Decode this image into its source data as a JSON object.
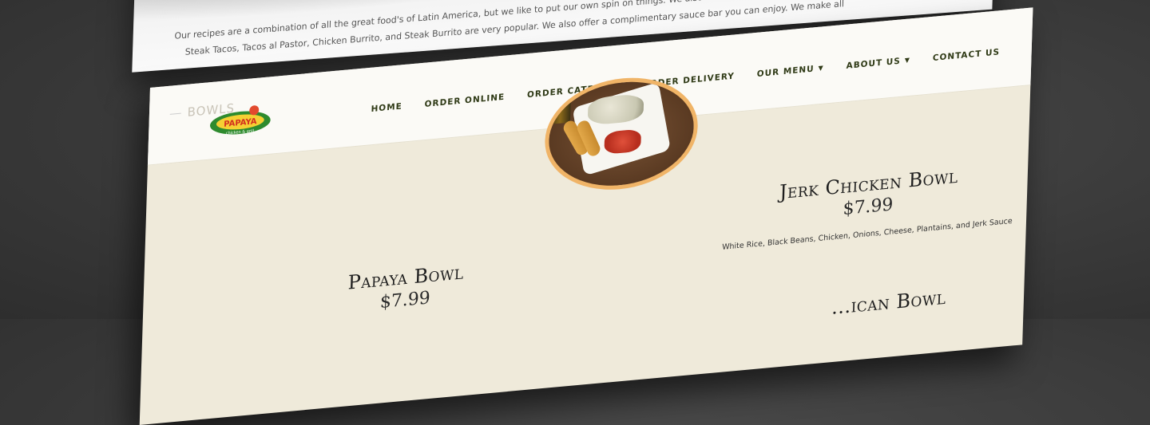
{
  "back_page": {
    "line1": "Our recipes are a combination of all the great food's of Latin America, but we like to put our own spin on things. We also offer a complimentary sauce bar you can enjoy. We make all our",
    "line2": "Steak Tacos, Tacos al Pastor, Chicken Burrito, and Steak Burrito are very popular. We also offer a complimentary sauce bar you can enjoy. We make all"
  },
  "header": {
    "faded_title": "BOWLS",
    "logo": {
      "brand": "PAPAYA",
      "tagline": "chicken & grill"
    },
    "nav": [
      {
        "label": "HOME"
      },
      {
        "label": "ORDER ONLINE"
      },
      {
        "label": "ORDER CATERING"
      },
      {
        "label": "ORDER DELIVERY"
      },
      {
        "label": "OUR MENU",
        "dropdown": true
      },
      {
        "label": "ABOUT US",
        "dropdown": true
      },
      {
        "label": "CONTACT US"
      }
    ]
  },
  "menu": {
    "items": [
      {
        "name": "Jerk Chicken Bowl",
        "price": "$7.99",
        "description": "White Rice, Black Beans, Chicken, Onions, Cheese, Plantains, and  Jerk Sauce"
      },
      {
        "name": "Papaya Bowl",
        "price": "$7.99"
      }
    ],
    "partial_title": "...ican Bowl"
  },
  "colors": {
    "page_bg": "#efeada",
    "header_bg": "#fbfaf6",
    "nav_text": "#2f3a16",
    "image_border": "#f0b467",
    "backdrop": "#3a3a3a"
  }
}
